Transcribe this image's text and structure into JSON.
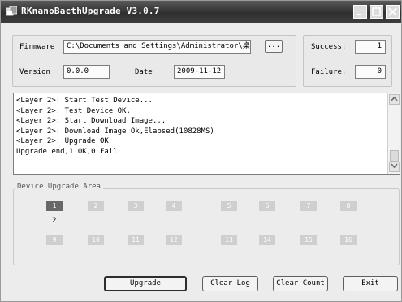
{
  "window": {
    "title": "RKnanoBacthUpgrade V3.0.7",
    "icons": {
      "app": "app-icon",
      "minimize": "minimize-icon",
      "maximize": "maximize-icon",
      "close": "close-icon"
    }
  },
  "firmware": {
    "label": "Firmware",
    "path": "C:\\Documents and Settings\\Administrator\\桌面",
    "browse_label": "..."
  },
  "version": {
    "label": "Version",
    "value": "0.0.0"
  },
  "date": {
    "label": "Date",
    "value": "2009-11-12"
  },
  "stats": {
    "success_label": "Success:",
    "success_value": "1",
    "failure_label": "Failure:",
    "failure_value": "0"
  },
  "log": {
    "lines": [
      "<Layer 2>: Start Test Device...",
      "<Layer 2>: Test Device OK.",
      "<Layer 2>: Start Download Image...",
      "<Layer 2>: Download Image Ok,Elapsed(10828MS)",
      "<Layer 2>: Upgrade OK",
      "Upgrade end,1 OK,0 Fail"
    ]
  },
  "device_area": {
    "legend": "Device Upgrade Area",
    "row1": [
      "1",
      "2",
      "3",
      "4",
      "5",
      "6",
      "7",
      "8"
    ],
    "row2": [
      "9",
      "10",
      "11",
      "12",
      "13",
      "14",
      "15",
      "16"
    ],
    "active_device": "1",
    "device1_count": "2"
  },
  "buttons": {
    "upgrade": "Upgrade",
    "clear_log": "Clear Log",
    "clear_count": "Clear Count",
    "exit": "Exit"
  },
  "colors": {
    "titlebar": "#3a3a3a",
    "device_active": "#686868",
    "device_idle": "#cfcfcf"
  }
}
